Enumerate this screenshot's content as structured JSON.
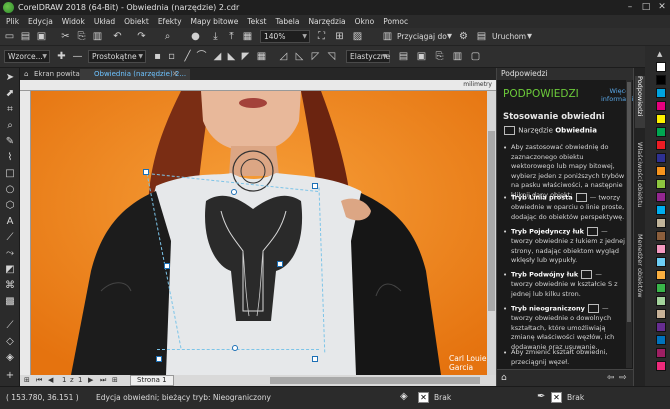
{
  "window": {
    "title": "CorelDRAW 2018 (64-Bit) - Obwiednia (narzędzie) 2.cdr"
  },
  "menu": [
    "Plik",
    "Edycja",
    "Widok",
    "Układ",
    "Obiekt",
    "Efekty",
    "Mapy bitowe",
    "Tekst",
    "Tabela",
    "Narzędzia",
    "Okno",
    "Pomoc"
  ],
  "toolbar1": {
    "zoom": "140%",
    "snap_label": "Przyciągaj do",
    "launch_label": "Uruchom"
  },
  "toolbar2": {
    "preset": "Wzorce...",
    "mode": "Prostokątne",
    "elastic": "Elastyczne"
  },
  "doctabs": [
    {
      "label": "Ekran powitalny"
    },
    {
      "label": "Obwiednia (narzędzie) 2..."
    }
  ],
  "ruler": {
    "unit": "milimetry"
  },
  "canvas": {
    "watermark": "Carl Louie Garcia"
  },
  "pagenav": {
    "current": "1",
    "of": "z",
    "total": "1",
    "page_tab": "Strona 1"
  },
  "statusbar": {
    "coords": "( 153.780, 36.151 )",
    "message": "Edycja obwiedni; bieżący tryb: Nieograniczony",
    "fill_label": "Brak",
    "outline_label": "Brak"
  },
  "docker": {
    "header": "Podpowiedzi",
    "title": "PODPOWIEDZI",
    "more_link": "Więcej informacji",
    "section": "Stosowanie obwiedni",
    "tool_prefix": "Narzędzie",
    "tool_name": "Obwiednia",
    "intro": "Aby zastosować obwiednię do zaznaczonego obiektu wektorowego lub mapy bitowej, wybierz jeden z poniższych trybów na pasku właściwości, a następnie kliknij dany obiekt:",
    "modes": [
      {
        "name": "Tryb Linia prosta",
        "desc": "— tworzy obwiednie w oparciu o linie proste, dodając do obiektów perspektywę."
      },
      {
        "name": "Tryb Pojedynczy łuk",
        "desc": "— tworzy obwiednie z łukiem z jednej strony, nadając obiektom wygląd wklęsły lub wypukły."
      },
      {
        "name": "Tryb Podwójny łuk",
        "desc": "— tworzy obwiednie w kształcie S z jednej lub kilku stron."
      },
      {
        "name": "Tryb nieograniczony",
        "desc": "— tworzy obwiednie o dowolnych kształtach, które umożliwiają zmianę właściwości węzłów, ich dodawanie oraz usuwanie."
      }
    ],
    "last": "Aby zmienić kształt obwiedni, przeciągnij węzeł."
  },
  "sidetabs": [
    "Podpowiedzi",
    "Właściwości obiektu",
    "Menedżer obiektów"
  ],
  "palette": [
    "#ffffff",
    "#000000",
    "#00a3e0",
    "#e6007e",
    "#fff200",
    "#00a651",
    "#ed1c24",
    "#2e3192",
    "#f7941d",
    "#8dc63f",
    "#92278f",
    "#00aeef",
    "#c2b59b",
    "#8b5e3c",
    "#f49ac1",
    "#6dcff6",
    "#fbb040",
    "#39b54a",
    "#a3d39c",
    "#c7b299",
    "#662d91",
    "#0072bc",
    "#9e1f63",
    "#ee2a7b"
  ]
}
